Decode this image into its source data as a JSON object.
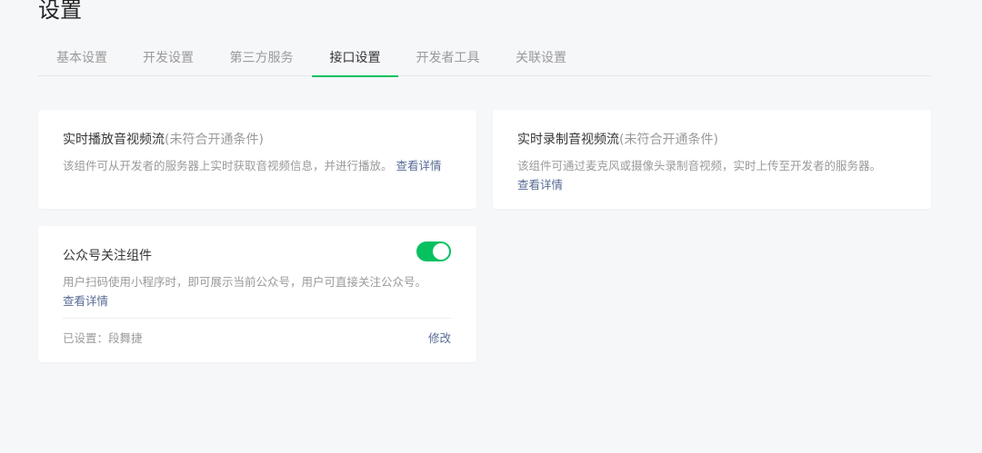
{
  "header": {
    "title": "设置"
  },
  "tabs": [
    {
      "label": "基本设置",
      "active": false
    },
    {
      "label": "开发设置",
      "active": false
    },
    {
      "label": "第三方服务",
      "active": false
    },
    {
      "label": "接口设置",
      "active": true
    },
    {
      "label": "开发者工具",
      "active": false
    },
    {
      "label": "关联设置",
      "active": false
    }
  ],
  "colors": {
    "accent": "#07c160",
    "link": "#576b95",
    "muted": "#9a9a9a"
  },
  "cards": {
    "live_play": {
      "title": "实时播放音视频流",
      "condition": "(未符合开通条件)",
      "description": "该组件可从开发者的服务器上实时获取音视频信息，并进行播放。",
      "link": "查看详情"
    },
    "live_record": {
      "title": "实时录制音视频流",
      "condition": "(未符合开通条件)",
      "description": "该组件可通过麦克风或摄像头录制音视频，实时上传至开发者的服务器。",
      "link": "查看详情"
    },
    "official_account": {
      "title": "公众号关注组件",
      "enabled": true,
      "description": "用户扫码使用小程序时，即可展示当前公众号，用户可直接关注公众号。",
      "link": "查看详情",
      "status_label": "已设置：",
      "status_value": "段舞捷",
      "edit_label": "修改"
    }
  }
}
